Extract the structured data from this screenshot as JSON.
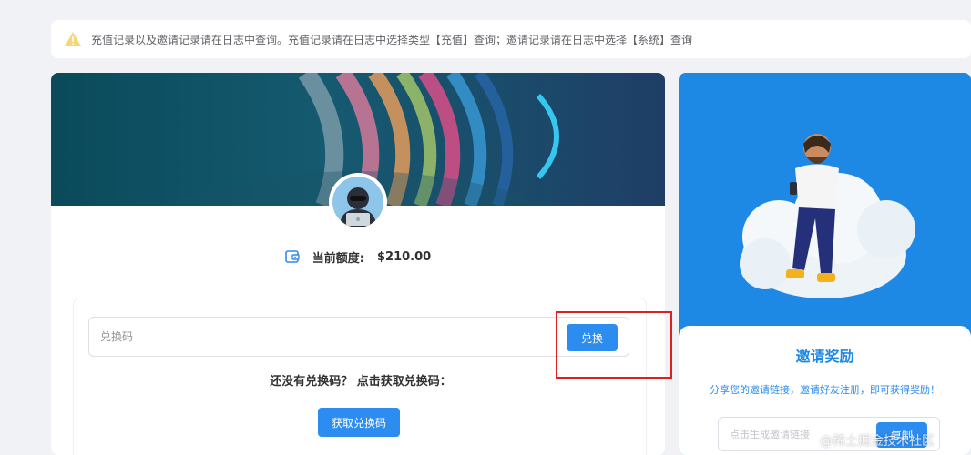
{
  "notice": {
    "icon": "warning-icon",
    "text": "充值记录以及邀请记录请在日志中查询。充值记录请在日志中选择类型【充值】查询；邀请记录请在日志中选择【系统】查询"
  },
  "balance": {
    "icon": "wallet-icon",
    "label": "当前额度:",
    "value": "$210.00"
  },
  "redeem": {
    "placeholder": "兑换码",
    "button_label": "兑换",
    "no_code_text": "还没有兑换码？ 点击获取兑换码：",
    "get_code_label": "获取兑换码"
  },
  "invite": {
    "title": "邀请奖励",
    "description": "分享您的邀请链接，邀请好友注册，即可获得奖励！",
    "link_placeholder": "点击生成邀请链接",
    "button_label": "复制"
  },
  "watermark": "@稀土掘金技术社区",
  "colors": {
    "accent": "#2d8cf0",
    "invite_bg": "#1e88e5",
    "highlight": "#e02020"
  }
}
